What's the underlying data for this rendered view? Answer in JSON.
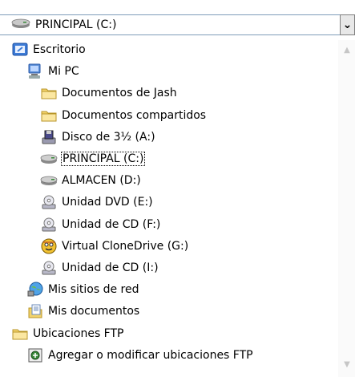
{
  "combo": {
    "value": "PRINCIPAL (C:)",
    "icon": "hard-drive-icon",
    "arrow": "⌄"
  },
  "tree": [
    {
      "label": "Escritorio",
      "icon": "desktop-icon",
      "level": 0
    },
    {
      "label": "Mi PC",
      "icon": "my-computer-icon",
      "level": 1
    },
    {
      "label": "Documentos de Jash",
      "icon": "folder-icon",
      "level": 2
    },
    {
      "label": "Documentos compartidos",
      "icon": "folder-icon",
      "level": 2
    },
    {
      "label": "Disco de 3½ (A:)",
      "icon": "floppy-drive-icon",
      "level": 2
    },
    {
      "label": "PRINCIPAL (C:)",
      "icon": "hard-drive-icon",
      "level": 2,
      "selected": true
    },
    {
      "label": "ALMACEN (D:)",
      "icon": "hard-drive-icon",
      "level": 2
    },
    {
      "label": "Unidad DVD (E:)",
      "icon": "optical-drive-icon",
      "level": 2
    },
    {
      "label": "Unidad de CD (F:)",
      "icon": "optical-drive-icon",
      "level": 2
    },
    {
      "label": "Virtual CloneDrive (G:)",
      "icon": "clonedrive-icon",
      "level": 2
    },
    {
      "label": "Unidad de CD (I:)",
      "icon": "optical-drive-icon",
      "level": 2
    },
    {
      "label": "Mis sitios de red",
      "icon": "network-places-icon",
      "level": 1
    },
    {
      "label": "Mis documentos",
      "icon": "my-documents-icon",
      "level": 1
    },
    {
      "label": "Ubicaciones FTP",
      "icon": "folder-icon",
      "level": 0
    },
    {
      "label": "Agregar o modificar ubicaciones FTP",
      "icon": "ftp-add-icon",
      "level": 1
    }
  ]
}
